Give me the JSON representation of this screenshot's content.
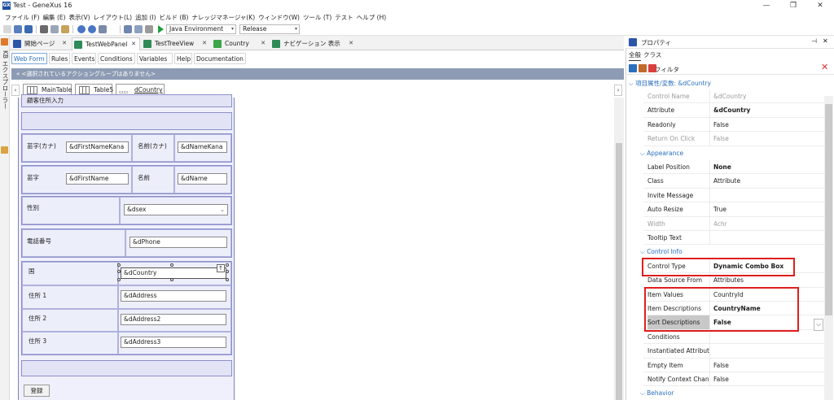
{
  "window": {
    "logo": "GX",
    "title": "Test - GeneXus 16",
    "minimize_glyph": "—",
    "restore_glyph": "❐",
    "close_glyph": "✕"
  },
  "menu": [
    "ファイル (F)",
    "編集 (E)",
    "表示(V)",
    "レイアウト(L)",
    "追加 (I)",
    "ビルド (B)",
    "ナレッジマネージャ(K)",
    "ウィンドウ(W)",
    "ツール (T)",
    "テスト",
    "ヘルプ (H)"
  ],
  "toolbar": {
    "environment": "Java Environment",
    "configuration": "Release"
  },
  "left_strip": {
    "label": "KB エクスプローラー"
  },
  "tabs": [
    {
      "label": "開始ページ",
      "close": "✕",
      "icon_color": "#2b55a8"
    },
    {
      "label": "TestWebPanel",
      "close": "✕",
      "icon_color": "#2e8b57"
    },
    {
      "label": "TestTreeView",
      "close": "✕",
      "icon_color": "#2e8b57"
    },
    {
      "label": "Country",
      "close": "✕",
      "icon_color": "#3aa64a"
    },
    {
      "label": "ナビゲーション 表示",
      "close": "✕",
      "icon_color": "#2e8b57"
    }
  ],
  "subtabs": [
    "Web Form",
    "Rules",
    "Events",
    "Conditions",
    "Variables",
    "Help",
    "Documentation"
  ],
  "action_bar": "« <選択されているアクショングループはありません>",
  "breadcrumb": {
    "left_arrow": "‹",
    "right_arrow": "›",
    "items": [
      "MainTable",
      "Table5",
      "dCountry"
    ]
  },
  "form": {
    "partial_label": "顧客住所入力",
    "rows": {
      "lastname_kana": {
        "label": "苗字(カナ)",
        "value": "&dFirstNameKana"
      },
      "firstname_kana": {
        "label": "名前(カナ)",
        "value": "&dNameKana"
      },
      "lastname": {
        "label": "苗字",
        "value": "&dFirstName"
      },
      "firstname": {
        "label": "名前",
        "value": "&dName"
      },
      "gender": {
        "label": "性別",
        "value": "&dsex"
      },
      "phone": {
        "label": "電話番号",
        "value": "&dPhone"
      },
      "country": {
        "label": "国",
        "value": "&dCountry"
      },
      "address1": {
        "label": "住所 1",
        "value": "&dAddress"
      },
      "address2": {
        "label": "住所 2",
        "value": "&dAddress2"
      },
      "address3": {
        "label": "住所 3",
        "value": "&dAddress3"
      }
    },
    "register_button": "登録"
  },
  "properties": {
    "title": "プロパティ",
    "pin": "⊣",
    "close": "✕",
    "tabs": [
      "全般",
      "クラス"
    ],
    "filter_label": "フィルタ",
    "clear": "✕",
    "object_header": "⌵ 項目属性/変数: &dCountry",
    "sections": [
      {
        "title": "",
        "rows": [
          {
            "name": "Control Name",
            "value": "&dCountry",
            "dim": true
          },
          {
            "name": "Attribute",
            "value": "&dCountry",
            "bold": true
          },
          {
            "name": "Readonly",
            "value": "False"
          },
          {
            "name": "Return On Click",
            "value": "False",
            "dim": true
          }
        ]
      },
      {
        "title": "⌵ Appearance",
        "rows": [
          {
            "name": "Label Position",
            "value": "None",
            "bold": true
          },
          {
            "name": "Class",
            "value": "Attribute"
          },
          {
            "name": "Invite Message",
            "value": ""
          },
          {
            "name": "Auto Resize",
            "value": "True"
          },
          {
            "name": "Width",
            "value": "4chr",
            "dim": true
          },
          {
            "name": "Tooltip Text",
            "value": ""
          }
        ]
      },
      {
        "title": "⌵ Control Info",
        "rows": [
          {
            "name": "Control Type",
            "value": "Dynamic Combo Box",
            "bold": true
          },
          {
            "name": "Data Source From",
            "value": "Attributes"
          },
          {
            "name": "Item Values",
            "value": "CountryId"
          },
          {
            "name": "Item Descriptions",
            "value": "CountryName",
            "bold": true
          },
          {
            "name": "Sort Descriptions",
            "value": "False",
            "bold": true,
            "selected": true
          },
          {
            "name": "Conditions",
            "value": ""
          },
          {
            "name": "Instantiated Attributes",
            "value": ""
          },
          {
            "name": "Empty Item",
            "value": "False"
          },
          {
            "name": "Notify Context Change",
            "value": "False"
          }
        ]
      },
      {
        "title": "⌵ Behavior",
        "rows": []
      }
    ],
    "dropdown_glyph": "⌵"
  }
}
